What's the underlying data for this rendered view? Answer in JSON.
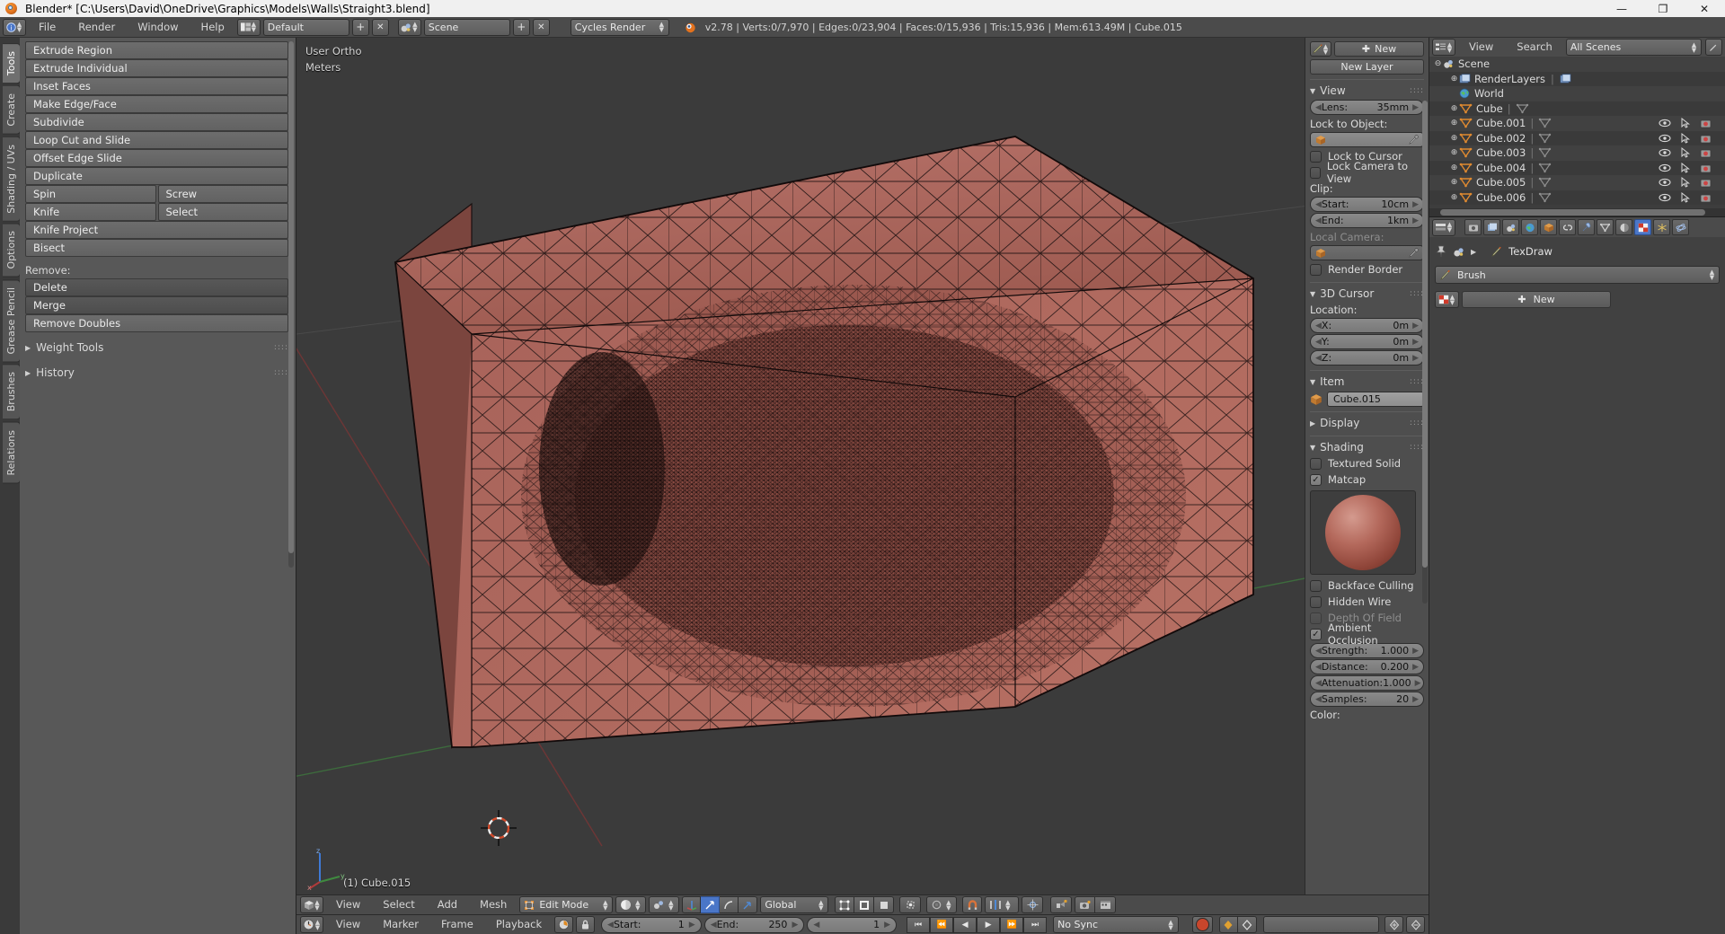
{
  "window": {
    "title": "Blender* [C:\\Users\\David\\OneDrive\\Graphics\\Models\\Walls\\Straight3.blend]",
    "minimize": "—",
    "maximize": "❐",
    "close": "✕"
  },
  "infobar": {
    "editor_icon": "info-editor-icon",
    "menus": [
      "File",
      "Render",
      "Window",
      "Help"
    ],
    "screen_layout": "Default",
    "scene_name": "Scene",
    "render_engine": "Cycles Render",
    "add_label": "+",
    "remove_label": "✕",
    "stats": "v2.78 | Verts:0/7,970 | Edges:0/23,904 | Faces:0/15,936 | Tris:15,936 | Mem:613.49M | Cube.015"
  },
  "toolshelf": {
    "tabs": [
      "Tools",
      "Create",
      "Shading / UVs",
      "Options",
      "Grease Pencil",
      "Brushes",
      "Relations"
    ],
    "active_tab": "Tools",
    "buttons": [
      "Extrude Region",
      "Extrude Individual",
      "Inset Faces",
      "Make Edge/Face",
      "Subdivide",
      "Loop Cut and Slide",
      "Offset Edge Slide",
      "Duplicate"
    ],
    "pair_rows": [
      [
        "Spin",
        "Screw"
      ],
      [
        "Knife",
        "Select"
      ]
    ],
    "buttons_after": [
      "Knife Project",
      "Bisect"
    ],
    "remove_label": "Remove:",
    "remove_buttons": [
      "Delete",
      "Merge",
      "Remove Doubles"
    ],
    "closed_panels": [
      "Weight Tools",
      "History"
    ]
  },
  "viewport": {
    "view_name": "User Ortho",
    "units": "Meters",
    "active_object_overlay": "(1) Cube.015",
    "axis_labels": {
      "x": "x",
      "y": "y",
      "z": "z"
    },
    "mesh_color": "#b06a5d",
    "background_color": "#3b3b3b"
  },
  "npanel": {
    "grease_pencil": {
      "new_label": "New",
      "new_layer_label": "New Layer"
    },
    "view": {
      "title": "View",
      "lens": {
        "label": "Lens:",
        "value": "35mm"
      },
      "lock_to_object_label": "Lock to Object:",
      "lock_object_value": "",
      "lock_to_cursor": {
        "label": "Lock to Cursor",
        "checked": false
      },
      "lock_camera_to_view": {
        "label": "Lock Camera to View",
        "checked": false
      },
      "clip_label": "Clip:",
      "clip_start": {
        "label": "Start:",
        "value": "10cm"
      },
      "clip_end": {
        "label": "End:",
        "value": "1km"
      },
      "local_camera_label": "Local Camera:",
      "local_camera_value": "",
      "render_border": {
        "label": "Render Border",
        "checked": false
      }
    },
    "cursor": {
      "title": "3D Cursor",
      "location_label": "Location:",
      "x": {
        "label": "X:",
        "value": "0m"
      },
      "y": {
        "label": "Y:",
        "value": "0m"
      },
      "z": {
        "label": "Z:",
        "value": "0m"
      }
    },
    "item": {
      "title": "Item",
      "object_name": "Cube.015"
    },
    "display": {
      "title": "Display"
    },
    "shading": {
      "title": "Shading",
      "textured_solid": {
        "label": "Textured Solid",
        "checked": false
      },
      "matcap": {
        "label": "Matcap",
        "checked": true
      },
      "backface_culling": {
        "label": "Backface Culling",
        "checked": false
      },
      "hidden_wire": {
        "label": "Hidden Wire",
        "checked": false
      },
      "depth_of_field": {
        "label": "Depth Of Field",
        "checked": false,
        "disabled": true
      },
      "ambient_occlusion": {
        "label": "Ambient Occlusion",
        "checked": true
      },
      "strength": {
        "label": "Strength:",
        "value": "1.000"
      },
      "distance": {
        "label": "Distance:",
        "value": "0.200"
      },
      "attenuation": {
        "label": "Attenuation:",
        "value": "1.000"
      },
      "samples": {
        "label": "Samples:",
        "value": "20"
      },
      "color_label": "Color:"
    }
  },
  "outliner": {
    "menus": [
      "View",
      "Search"
    ],
    "display_mode": "All Scenes",
    "rows": [
      {
        "name": "Scene",
        "icon": "scene-icon",
        "indent": 0,
        "expander": "⊖"
      },
      {
        "name": "RenderLayers",
        "icon": "renderlayers-icon",
        "indent": 1,
        "expander": "⊕"
      },
      {
        "name": "World",
        "icon": "world-icon",
        "indent": 1,
        "expander": ""
      },
      {
        "name": "Cube",
        "icon": "mesh-icon",
        "indent": 1,
        "expander": "⊕"
      },
      {
        "name": "Cube.001",
        "icon": "mesh-icon",
        "indent": 1,
        "expander": "⊕"
      },
      {
        "name": "Cube.002",
        "icon": "mesh-icon",
        "indent": 1,
        "expander": "⊕"
      },
      {
        "name": "Cube.003",
        "icon": "mesh-icon",
        "indent": 1,
        "expander": "⊕"
      },
      {
        "name": "Cube.004",
        "icon": "mesh-icon",
        "indent": 1,
        "expander": "⊕"
      },
      {
        "name": "Cube.005",
        "icon": "mesh-icon",
        "indent": 1,
        "expander": "⊕"
      },
      {
        "name": "Cube.006",
        "icon": "mesh-icon",
        "indent": 1,
        "expander": "⊕"
      }
    ]
  },
  "properties": {
    "tabs": [
      "render-tab",
      "renderlayers-tab",
      "scene-tab",
      "world-tab",
      "object-tab",
      "constraints-tab",
      "modifiers-tab",
      "data-tab",
      "material-tab",
      "texture-tab",
      "particles-tab",
      "physics-tab"
    ],
    "active_tab": "texture-tab",
    "breadcrumb_pin": "pin-icon",
    "breadcrumb_scene": "scene-icon",
    "breadcrumb_brush": "TexDraw",
    "brush_selector": "Brush",
    "new_texture_label": "New"
  },
  "viewport_footer": {
    "editor_icon": "3d-view-icon",
    "menus": [
      "View",
      "Select",
      "Add",
      "Mesh"
    ],
    "mode": "Edit Mode",
    "viewport_shading": "solid-shading-icon",
    "pivot": "median-point-icon",
    "select_modes": [
      "vertex-select-icon",
      "edge-select-icon",
      "face-select-icon"
    ],
    "transform_orientation": "Global",
    "proportional_edit": "proportional-off-icon",
    "snap_magnet": "magnet-icon",
    "snap_element": "snap-increment-icon",
    "manipulator_icons": [
      "translate-manipulator-icon",
      "rotate-manipulator-icon",
      "scale-manipulator-icon"
    ]
  },
  "timeline": {
    "editor_icon": "timeline-icon",
    "menus": [
      "View",
      "Marker",
      "Frame",
      "Playback"
    ],
    "start": {
      "label": "Start:",
      "value": "1"
    },
    "end": {
      "label": "End:",
      "value": "250"
    },
    "current_frame": "1",
    "sync_mode": "No Sync",
    "transport": [
      "jump-start-icon",
      "prev-keyframe-icon",
      "play-reverse-icon",
      "play-icon",
      "next-keyframe-icon",
      "jump-end-icon"
    ],
    "record_label": "record-icon"
  }
}
